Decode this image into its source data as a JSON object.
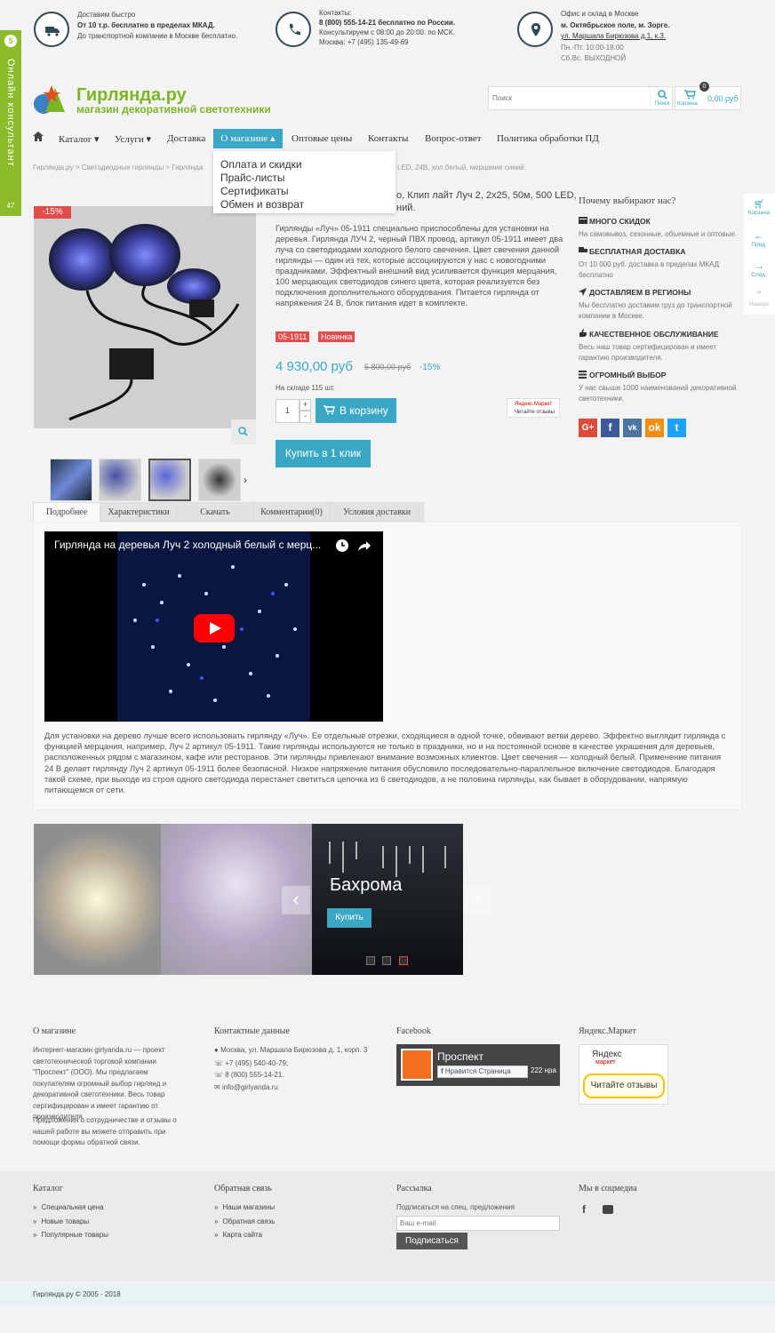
{
  "header": {
    "delivery": {
      "line1": "Доставим быстро",
      "line2": "От 10 т.р. бесплатно в пределах МКАД.",
      "line3": "До транспортной компании в Москве бесплатно."
    },
    "contacts": {
      "line1": "Контакты:",
      "line2": "8 (800) 555-14-21 бесплатно по России.",
      "line3": "Консультируем с 08:00 до 20:00. по МСК.",
      "line4": "Москва: +7 (495) 135-49-69"
    },
    "office": {
      "line1": "Офис и склад в Москве",
      "line2": "м. Октябрьское поле, м. Зорге.",
      "line3": "ул. Маршала Бирюзова д.1, к.3.",
      "line4": "Пн.-Пт. 10:00-18:00",
      "line5": "Сб.Вс. ВЫХОДНОЙ"
    }
  },
  "logo": {
    "title": "Гирлянда.ру",
    "subtitle": "магазин декоративной светотехники"
  },
  "search": {
    "placeholder": "Поиск",
    "button_label": "Поиск"
  },
  "cart": {
    "label": "Корзина",
    "count": "0",
    "total": "0,00 руб"
  },
  "nav": {
    "catalog": "Каталог",
    "services": "Услуги",
    "delivery": "Доставка",
    "about": "О магазине",
    "wholesale": "Оптовые цены",
    "contacts": "Контакты",
    "faq": "Вопрос-ответ",
    "policy": "Политика обработки ПД"
  },
  "dropdown": [
    "Оплата и скидки",
    "Прайс-листы",
    "Сертификаты",
    "Обмен и возврат"
  ],
  "breadcrumb": {
    "home": "Гирлянда.ру",
    "sep": ">",
    "cat": "Светодиодные гирлянды",
    "sub": "Гирлянда",
    "tail": "LED, 24В, хол.белый, мерцание синий."
  },
  "online_consultant": {
    "label": "Онлайн консультант",
    "count": "47"
  },
  "product": {
    "discount_badge": "-15%",
    "title_part1": "о, Клип лайт Луч 2, 2х25, 50м, 500 LED,",
    "title_part2": "ний.",
    "description": "Гирлянды «Луч» 05-1911 специально приспособлены для установки на деревья. Гирлянда ЛУЧ 2, черный ПВХ провод, артикул 05-1911 имеет два луча со светодиодами холодного белого свечения. Цвет свечения данной гирлянды — один из тех, которые ассоциируются у нас с новогодними праздниками. Эффектный внешний вид усиливается функция мерцания, 100 мерцающих светодиодов синего цвета, которая реализуется без подключения дополнительного оборудования. Питается гирлянда от напряжения 24 В, блок питания идет в комплекте.",
    "sku_label": "05-1911",
    "new_label": "Новинка",
    "price": "4 930,00 руб",
    "old_price": "5 800,00 руб",
    "discount": "-15%",
    "stock": "На складе 115 шт.",
    "qty": "1",
    "qty_plus": "+",
    "qty_minus": "-",
    "add_to_cart": "В корзину",
    "buy_one_click": "Купить в 1 клик",
    "ym_line1": "Яндекс.Маркет",
    "ym_line2": "Читайте отзывы"
  },
  "why": {
    "title": "Почему выбирают нас?",
    "items": [
      {
        "title": "МНОГО СКИДОК",
        "text": "На самовывоз, сезонные, объемные и оптовые."
      },
      {
        "title": "БЕСПЛАТНАЯ ДОСТАВКА",
        "text": "От 10 000 руб. доставка в пределах МКАД бесплатно"
      },
      {
        "title": "ДОСТАВЛЯЕМ В РЕГИОНЫ",
        "text": "Мы бесплатно доставим груз до транспортной компании в Москве."
      },
      {
        "title": "КАЧЕСТВЕННОЕ ОБСЛУЖИВАНИЕ",
        "text": "Весь наш товар сертифицирован и имеет гарантию производителя."
      },
      {
        "title": "ОГРОМНЫЙ ВЫБОР",
        "text": "У нас свыше 1000 наименований декоративной светотехники."
      }
    ]
  },
  "right_panel": {
    "cart": "Корзина",
    "prev": "Пред.",
    "next": "След.",
    "top": "Наверх"
  },
  "tabs": [
    "Подробнее",
    "Характеристики",
    "Скачать",
    "Комментарии(0)",
    "Условия доставки"
  ],
  "video": {
    "title": "Гирлянда на деревья Луч 2 холодный белый с мерц..."
  },
  "article": "Для установки на дерево лучше всего использовать гирлянду «Луч». Ее отдельные отрезки, сходящиеся в одной точке, обвивают ветви дерево. Эффектно выглядит гирлянда с функцией мерцания, например, Луч 2 артикул 05-1911. Такие гирлянды используются не только в праздники, но и на постоянной основе в качестве украшения для деревьев, расположенных рядом с магазином, кафе или ресторанов. Эти гирлянды привлекают внимание возможных клиентов. Цвет свечения — холодный белый. Применение питания 24 В делает гирлянду Луч 2 артикул 05-1911 более безопасной. Низкое напряжение питания обусловило последовательно-параллельное включение светодиодов. Благодаря такой схеме, при выходе из строя одного светодиода перестанет светиться цепочка из 6 светодиодов, а не половина гирлянды, как бывает в оборудовании, напрямую питающемся от сети.",
  "slider": {
    "caption": "Бахрома",
    "button": "Купить"
  },
  "footer": {
    "about_title": "О магазине",
    "about_text1": "Интернет-магазин girlyanda.ru — проект светотехнической торговой компании \"Проспект\" (ООО). Мы предлагаем покупателям огромный выбор гирлянд и декоративной светотехники. Весь товар сертифицирован и имеет гарантию от производителя.",
    "about_text2": "Предложения о сотрудничестве и отзывы о нашей работе вы можете отправить при помощи формы обратной связи.",
    "contacts_title": "Контактные данные",
    "address": "Москва, ул. Маршала Бирюзова д. 1, корп. 3",
    "phone1": "+7 (495) 540-40-79;",
    "phone2": "8 (800) 555-14-21.",
    "email": "info@girlyanda.ru",
    "fb_title": "Facebook",
    "fb_page": "Проспект",
    "fb_like": "Нравится Страница",
    "fb_count": "222 нра",
    "ym_title": "Яндекс.Маркет",
    "ym_logo": "Яндекс",
    "ym_sub": "маркет",
    "ym_reviews": "Читайте отзывы",
    "catalog_title": "Каталог",
    "catalog_items": [
      "Специальная цена",
      "Новые товары",
      "Популярные товары"
    ],
    "feedback_title": "Обратная связь",
    "feedback_items": [
      "Наши магазины",
      "Обратная связь",
      "Карта сайта"
    ],
    "news_title": "Рассылка",
    "news_text": "Подписаться на спец. предложения",
    "email_placeholder": "Ваш e-mail",
    "subscribe": "Подписаться",
    "social_title": "Мы в соцмедиа",
    "copyright": "Гирлянда.ру © 2005 - 2018"
  }
}
